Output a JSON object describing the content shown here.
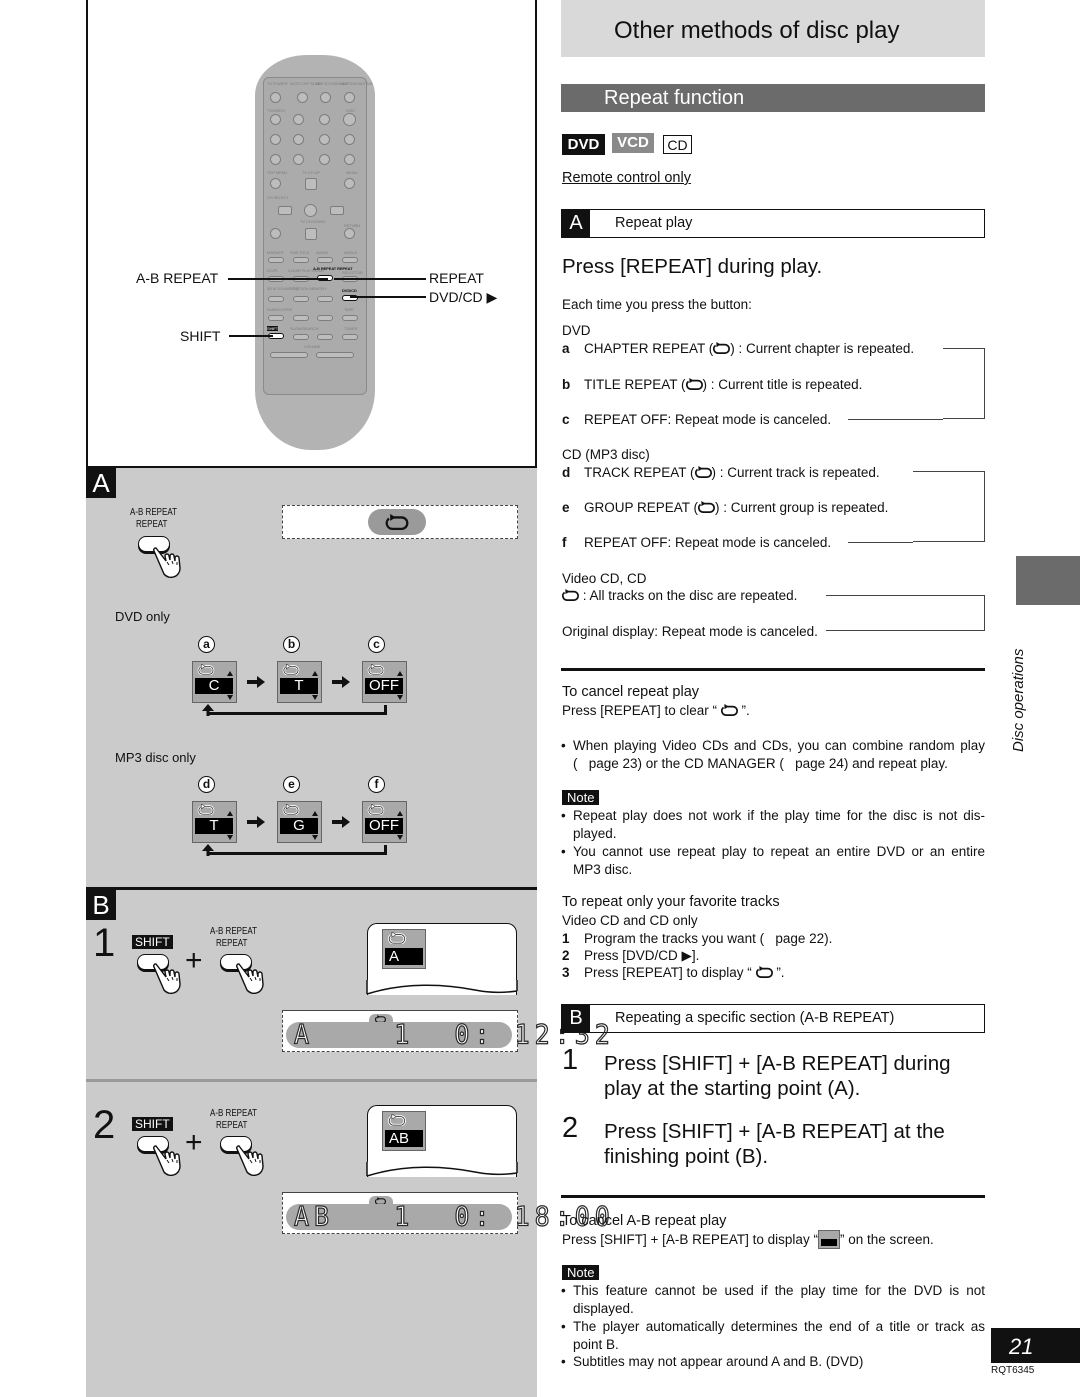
{
  "left_panel": {
    "remote_callouts": {
      "ab_repeat": "A-B REPEAT",
      "shift": "SHIFT",
      "repeat": "REPEAT",
      "dvd_cd": "DVD/CD ▶"
    },
    "remote_labels": [
      "TV POWER",
      "AUTO OFF SLEEP",
      "MIX 2CH DIMMER",
      "ACTION MUTING",
      "TV/VIDEO",
      "DISC",
      "≧10",
      "TOP MENU",
      "TV CH UP",
      "MENU",
      "CH SELECT",
      "ENTER",
      "TV CH DOWN",
      "RETURN",
      "MARKER",
      "SUB TITLE",
      "AUDIO",
      "ANGLE",
      "DC/PL",
      "CLEAR PLAY MODE",
      "A-B REPEAT REPEAT",
      "SELECTOR",
      "3D AI SOUND EQ",
      "POSITION MEMORY",
      "DVD/CD",
      "SUBWOOFER",
      "TAPE",
      "SHIFT",
      "SLOW/SEARCH",
      "TUNER",
      "VOLUME"
    ],
    "section_a": {
      "tag": "A",
      "button_label_top": "A-B REPEAT",
      "button_label_bottom": "REPEAT",
      "dvd_only": "DVD only",
      "dvd_sequence": [
        {
          "letter": "a",
          "display": "C"
        },
        {
          "letter": "b",
          "display": "T"
        },
        {
          "letter": "c",
          "display": "OFF"
        }
      ],
      "mp3_only": "MP3 disc only",
      "mp3_sequence": [
        {
          "letter": "d",
          "display": "T"
        },
        {
          "letter": "e",
          "display": "G"
        },
        {
          "letter": "f",
          "display": "OFF"
        }
      ]
    },
    "section_b": {
      "tag": "B",
      "steps": [
        {
          "num": "1",
          "shift": "SHIFT",
          "plus": "+",
          "btn_top": "A-B REPEAT",
          "btn_bottom": "REPEAT",
          "osd": "A",
          "lcd": "A    1  0: 12:32"
        },
        {
          "num": "2",
          "shift": "SHIFT",
          "plus": "+",
          "btn_top": "A-B REPEAT",
          "btn_bottom": "REPEAT",
          "osd": "AB",
          "lcd": "AB   1  0: 18:00"
        }
      ]
    }
  },
  "right_panel": {
    "page_title": "Other methods of disc play",
    "section_title": "Repeat function",
    "badges": [
      "DVD",
      "VCD",
      "CD"
    ],
    "remote_only": "Remote control only",
    "box_a": {
      "tag": "A",
      "title": "Repeat play"
    },
    "instruction_a": "Press [REPEAT] during play.",
    "each_time": "Each time you press the button:",
    "dvd_head": "DVD",
    "dvd_items": [
      {
        "letter": "a",
        "pre": "CHAPTER REPEAT (",
        "post": ") : Current chapter is repeated."
      },
      {
        "letter": "b",
        "pre": "TITLE REPEAT (",
        "post": ") : Current title is repeated."
      },
      {
        "letter": "c",
        "pre": "REPEAT OFF: Repeat mode is canceled.",
        "post": ""
      }
    ],
    "cd_head": "CD (MP3 disc)",
    "cd_items": [
      {
        "letter": "d",
        "pre": "TRACK REPEAT (",
        "post": ") : Current track is repeated."
      },
      {
        "letter": "e",
        "pre": "GROUP REPEAT (",
        "post": ") : Current group is repeated."
      },
      {
        "letter": "f",
        "pre": "REPEAT OFF: Repeat mode is canceled.",
        "post": ""
      }
    ],
    "vcd_head": "Video CD, CD",
    "vcd_all": " :  All tracks on the disc are repeated.",
    "vcd_original": "Original display:  Repeat mode is canceled.",
    "cancel_head": "To cancel repeat play",
    "cancel_pre": "Press [REPEAT] to clear “ ",
    "cancel_post": " ”.",
    "combine_bullet": "When playing Video CDs and CDs, you can combine random play (   page 23) or the CD MANAGER (   page 24) and repeat play.",
    "note_label": "Note",
    "notes_a": [
      "Repeat play does not work if the play time for the disc is not dis-played.",
      "You cannot use repeat play to repeat an entire DVD or an entire MP3 disc."
    ],
    "fav_head": "To repeat only your favorite tracks",
    "fav_sub": "Video CD and CD only",
    "fav_steps": [
      {
        "num": "1",
        "text": "Program the tracks you want (   page 22)."
      },
      {
        "num": "2",
        "text": "Press [DVD/CD ▶]."
      },
      {
        "num": "3",
        "pre": "Press [REPEAT] to display “ ",
        "post": " ”."
      }
    ],
    "box_b": {
      "tag": "B",
      "title": "Repeating a specific section (A-B REPEAT)"
    },
    "ab_steps": [
      {
        "num": "1",
        "line1": "Press [SHIFT] + [A-B REPEAT] during",
        "line2": "play at the starting point (A)."
      },
      {
        "num": "2",
        "line1": "Press [SHIFT] + [A-B REPEAT] at the",
        "line2": "finishing point (B)."
      }
    ],
    "cancel_ab_head": "To cancel A-B repeat play",
    "cancel_ab_pre": "Press [SHIFT] + [A-B REPEAT] to display “",
    "cancel_ab_post": "” on the screen.",
    "notes_b": [
      "This feature cannot be used if the play time for the DVD is not displayed.",
      "The player automatically determines the end of a title or track as point B.",
      "Subtitles may not appear around A and B. (DVD)"
    ]
  },
  "side": {
    "tab_text": "Disc operations",
    "page_number": "21",
    "doc_code": "RQT6345"
  },
  "colors": {
    "dark": "#111111",
    "panel_gray": "#cbcbcb",
    "section_bar": "#6b6b6b",
    "title_bar": "#d9d9d9"
  }
}
